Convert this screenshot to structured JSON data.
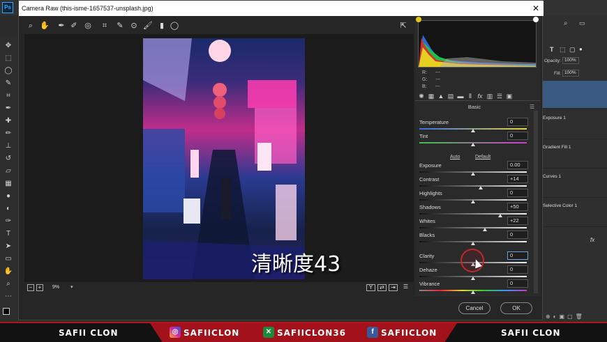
{
  "window": {
    "title": "Camera Raw (this-isme-1657537-unsplash.jpg)",
    "close_glyph": "✕"
  },
  "ps": {
    "logo": "Ps"
  },
  "layers_panel": {
    "opacity_label": "Opacity:",
    "opacity_value": "100%",
    "fill_label": "Fill:",
    "fill_value": "100%",
    "layers": [
      "Exposure 1",
      "Gradient Fill 1",
      "Curves 1",
      "Selective Color 1"
    ],
    "fx": "fx"
  },
  "histogram": {
    "r_label": "R:",
    "g_label": "G:",
    "b_label": "B:",
    "r_value": "---",
    "g_value": "---",
    "b_value": "---"
  },
  "panel": {
    "title": "Basic",
    "auto_label": "Auto",
    "default_label": "Default",
    "sliders": [
      {
        "label": "Temperature",
        "value": "0",
        "pos": 0.5,
        "track": "temp"
      },
      {
        "label": "Tint",
        "value": "0",
        "pos": 0.5,
        "track": "tint"
      },
      {
        "label": "Exposure",
        "value": "0.00",
        "pos": 0.5,
        "track": "gray"
      },
      {
        "label": "Contrast",
        "value": "+14",
        "pos": 0.57,
        "track": "gray"
      },
      {
        "label": "Highlights",
        "value": "0",
        "pos": 0.5,
        "track": "gray"
      },
      {
        "label": "Shadows",
        "value": "+50",
        "pos": 0.75,
        "track": "gray"
      },
      {
        "label": "Whites",
        "value": "+22",
        "pos": 0.61,
        "track": "gray"
      },
      {
        "label": "Blacks",
        "value": "0",
        "pos": 0.5,
        "track": "gray"
      },
      {
        "label": "Clarity",
        "value": "0",
        "pos": 0.5,
        "track": "gray"
      },
      {
        "label": "Dehaze",
        "value": "0",
        "pos": 0.5,
        "track": "gray"
      },
      {
        "label": "Vibrance",
        "value": "0",
        "pos": 0.5,
        "track": "vib"
      }
    ]
  },
  "status": {
    "zoom": "9%"
  },
  "buttons": {
    "cancel": "Cancel",
    "ok": "OK"
  },
  "subtitle": "清晰度43",
  "banner": {
    "left_name": "SAFII CLON",
    "instagram": "SAFIICLON",
    "other": "SAFIICLON36",
    "facebook": "SAFIICLON",
    "right_name": "SAFII CLON"
  },
  "colors": {
    "accent_red": "#b3151d",
    "selection_blue": "#3a5a82"
  }
}
